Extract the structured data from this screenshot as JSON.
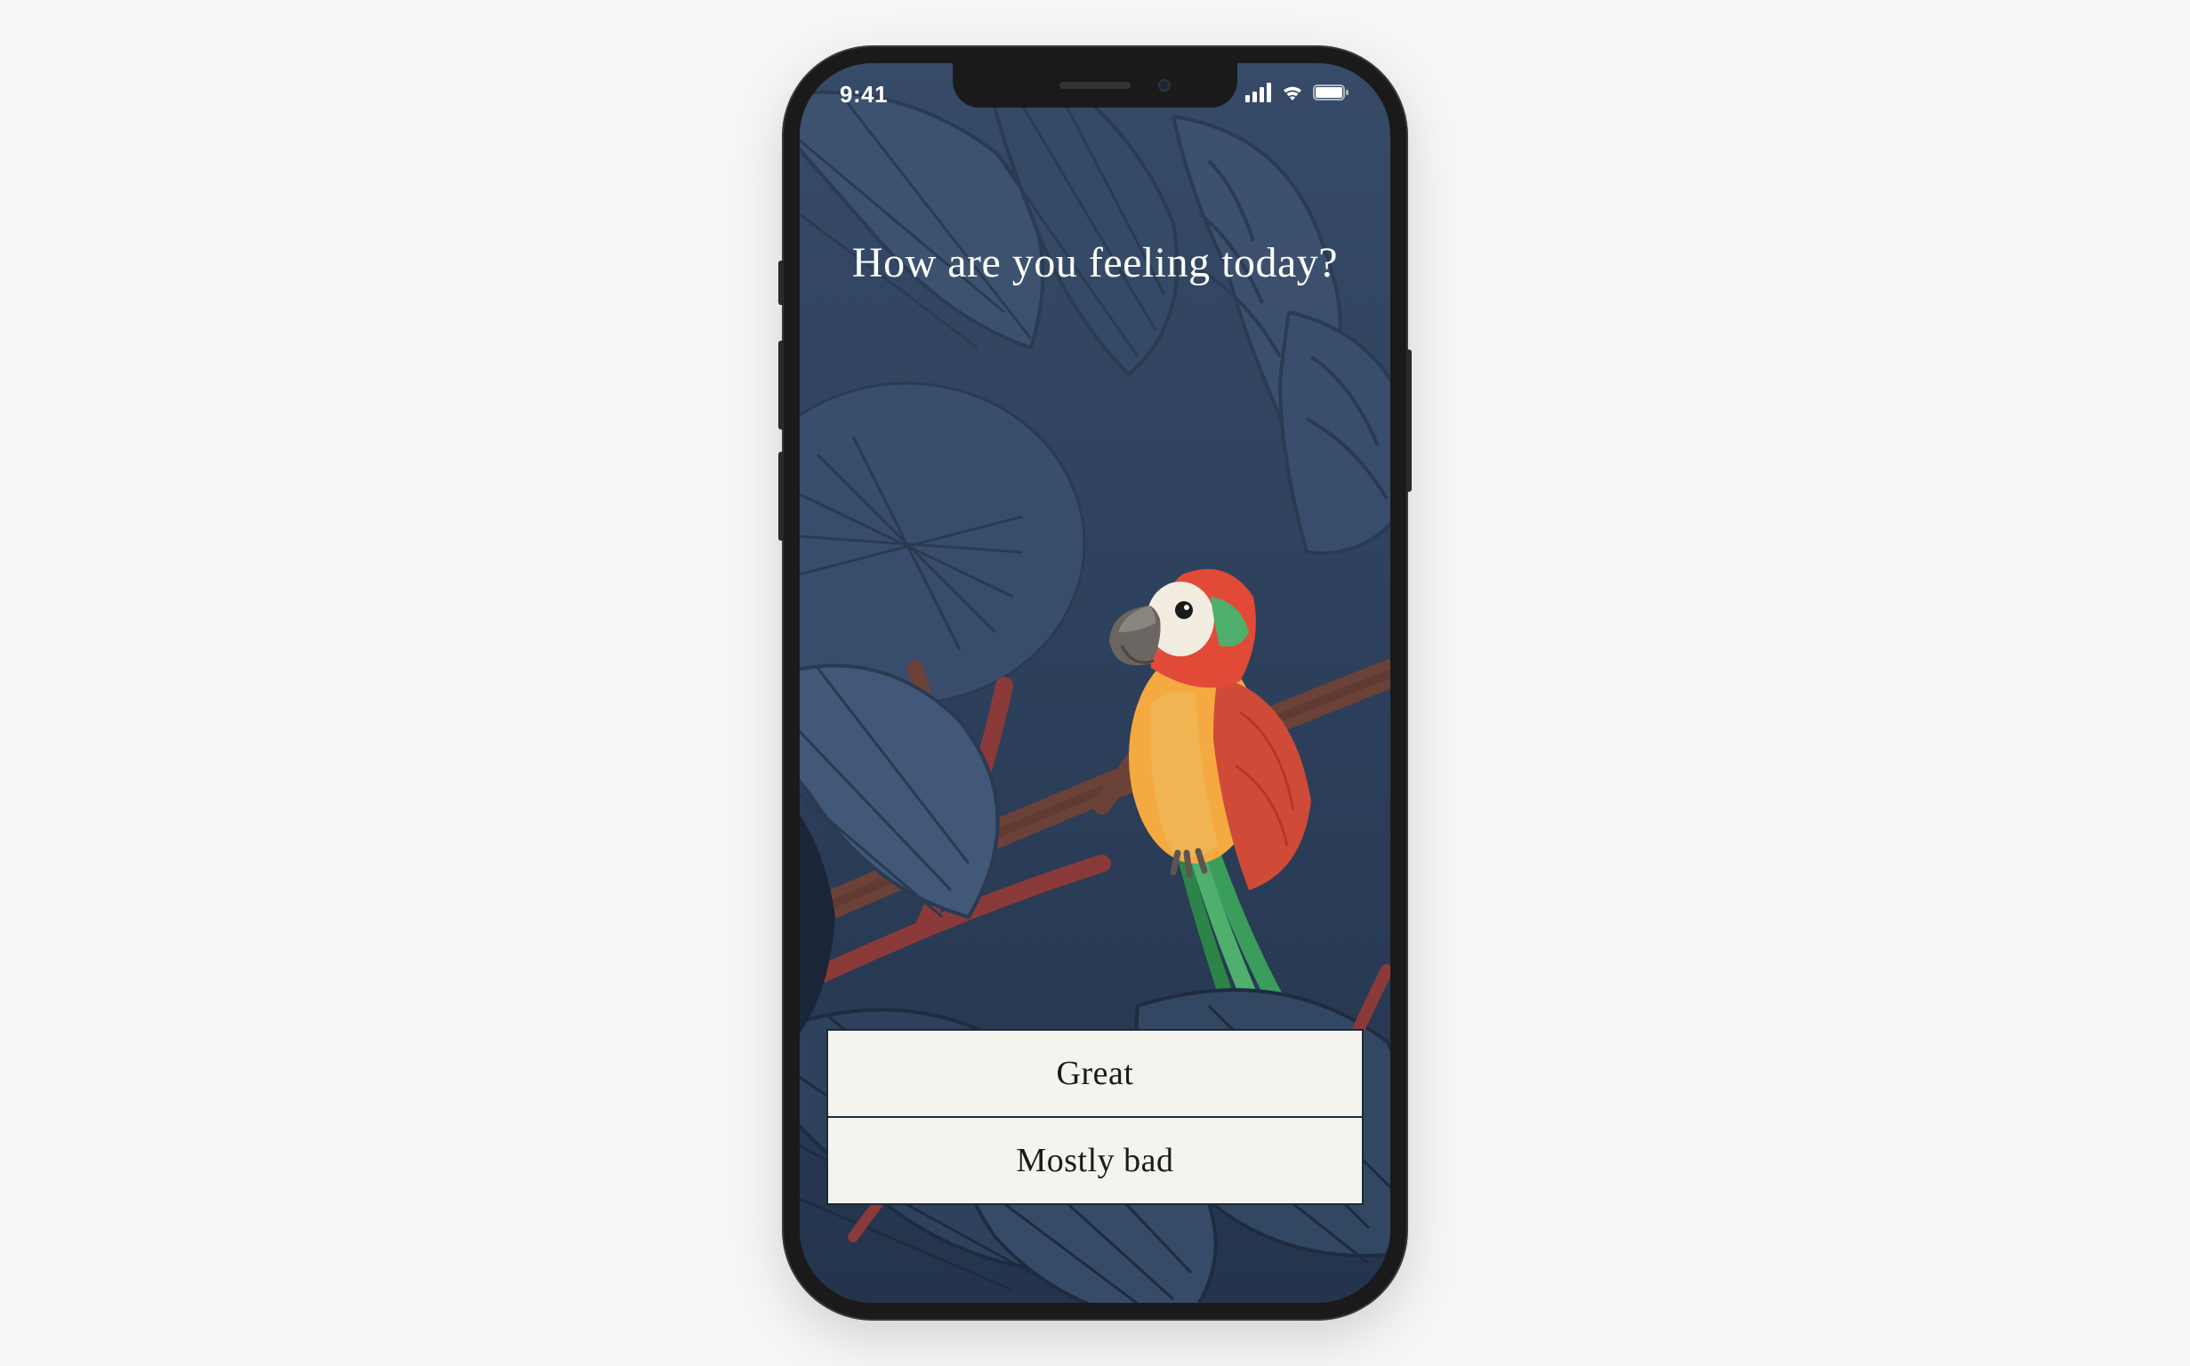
{
  "status_bar": {
    "time": "9:41"
  },
  "question": "How are you feeling today?",
  "options": [
    {
      "label": "Great"
    },
    {
      "label": "Mostly bad"
    }
  ]
}
